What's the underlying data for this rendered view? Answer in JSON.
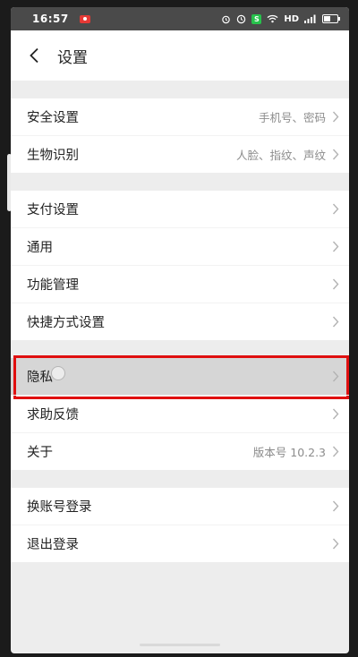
{
  "status_bar": {
    "time": "16:57",
    "network": "HD"
  },
  "header": {
    "title": "设置"
  },
  "groups": [
    {
      "rows": [
        {
          "label": "安全设置",
          "value": "手机号、密码"
        },
        {
          "label": "生物识别",
          "value": "人脸、指纹、声纹"
        }
      ]
    },
    {
      "rows": [
        {
          "label": "支付设置",
          "value": ""
        },
        {
          "label": "通用",
          "value": ""
        },
        {
          "label": "功能管理",
          "value": ""
        },
        {
          "label": "快捷方式设置",
          "value": ""
        }
      ]
    },
    {
      "rows": [
        {
          "label": "隐私",
          "value": ""
        },
        {
          "label": "求助反馈",
          "value": ""
        },
        {
          "label": "关于",
          "value": "版本号 10.2.3"
        }
      ]
    },
    {
      "rows": [
        {
          "label": "换账号登录",
          "value": ""
        },
        {
          "label": "退出登录",
          "value": ""
        }
      ]
    }
  ],
  "colors": {
    "highlight_border": "#e01010",
    "background": "#ededed"
  }
}
